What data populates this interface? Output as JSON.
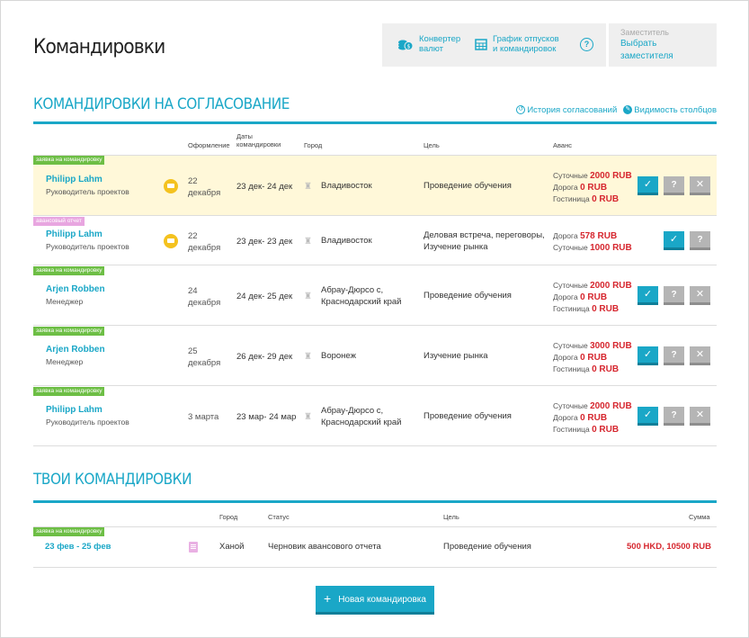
{
  "page": {
    "title": "Командировки"
  },
  "toolbar": {
    "converter_l1": "Конвертер",
    "converter_l2": "валют",
    "schedule_l1": "График отпусков",
    "schedule_l2": "и командировок",
    "help": "?",
    "deputy_caption": "Заместитель",
    "deputy_link": "Выбрать заместителя"
  },
  "approval": {
    "title": "Командировки на согласование",
    "history_link": "История согласований",
    "columns_link": "Видимость столбцов",
    "headers": {
      "registration": "Оформление",
      "dates_l1": "Даты",
      "dates_l2": "командировки",
      "city": "Город",
      "goal": "Цель",
      "advance": "Аванс"
    },
    "rows": [
      {
        "tag": "заявка на командировку",
        "name": "Philipp Lahm",
        "role": "Руководитель проектов",
        "date_l1": "22",
        "date_l2": "декабря",
        "dates": "23 дек- 24 дек",
        "city_l1": "Владивосток",
        "city_l2": "",
        "goal_l1": "Проведение обучения",
        "goal_l2": "",
        "adv": [
          {
            "label": "Суточные",
            "value": "2000 RUB"
          },
          {
            "label": "Дорога",
            "value": "0 RUB"
          },
          {
            "label": "Гостиница",
            "value": "0 RUB"
          }
        ]
      },
      {
        "tag": "авансовый отчет",
        "name": "Philipp Lahm",
        "role": "Руководитель проектов",
        "date_l1": "22",
        "date_l2": "декабря",
        "dates": "23 дек- 23 дек",
        "city_l1": "Владивосток",
        "city_l2": "",
        "goal_l1": "Деловая встреча, переговоры,",
        "goal_l2": "Изучение рынка",
        "adv": [
          {
            "label": "Дорога",
            "value": "578 RUB"
          },
          {
            "label": "Суточные",
            "value": "1000 RUB"
          }
        ]
      },
      {
        "tag": "заявка на командировку",
        "name": "Arjen Robben",
        "role": "Менеджер",
        "date_l1": "24",
        "date_l2": "декабря",
        "dates": "24 дек- 25 дек",
        "city_l1": "Абрау-Дюрсо с,",
        "city_l2": "Краснодарский край",
        "goal_l1": "Проведение обучения",
        "goal_l2": "",
        "adv": [
          {
            "label": "Суточные",
            "value": "2000 RUB"
          },
          {
            "label": "Дорога",
            "value": "0 RUB"
          },
          {
            "label": "Гостиница",
            "value": "0 RUB"
          }
        ]
      },
      {
        "tag": "заявка на командировку",
        "name": "Arjen Robben",
        "role": "Менеджер",
        "date_l1": "25",
        "date_l2": "декабря",
        "dates": "26 дек- 29 дек",
        "city_l1": "Воронеж",
        "city_l2": "",
        "goal_l1": "Изучение рынка",
        "goal_l2": "",
        "adv": [
          {
            "label": "Суточные",
            "value": "3000 RUB"
          },
          {
            "label": "Дорога",
            "value": "0 RUB"
          },
          {
            "label": "Гостиница",
            "value": "0 RUB"
          }
        ]
      },
      {
        "tag": "заявка на командировку",
        "name": "Philipp Lahm",
        "role": "Руководитель проектов",
        "date_l1": "3 марта",
        "date_l2": "",
        "dates": "23 мар- 24 мар",
        "city_l1": "Абрау-Дюрсо с,",
        "city_l2": "Краснодарский край",
        "goal_l1": "Проведение обучения",
        "goal_l2": "",
        "adv": [
          {
            "label": "Суточные",
            "value": "2000 RUB"
          },
          {
            "label": "Дорога",
            "value": "0 RUB"
          },
          {
            "label": "Гостиница",
            "value": "0 RUB"
          }
        ]
      }
    ]
  },
  "mine": {
    "title": "Твои командировки",
    "headers": {
      "city": "Город",
      "status": "Статус",
      "goal": "Цель",
      "sum": "Сумма"
    },
    "rows": [
      {
        "tag": "заявка на командировку",
        "dates": "23 фев - 25 фев",
        "city": "Ханой",
        "status": "Черновик авансового отчета",
        "goal": "Проведение обучения",
        "sum": "500 HKD, 10500 RUB"
      }
    ]
  },
  "new_trip": {
    "label": "Новая командировка",
    "plus": "+"
  },
  "icons": {
    "check": "✓",
    "question": "?",
    "close": "✕"
  },
  "colors": {
    "accent": "#1aa7c7",
    "highlight": "#fff8d9",
    "tag_green": "#6dbe45",
    "tag_pink": "#e8a6e0",
    "money_red": "#d6272f"
  }
}
